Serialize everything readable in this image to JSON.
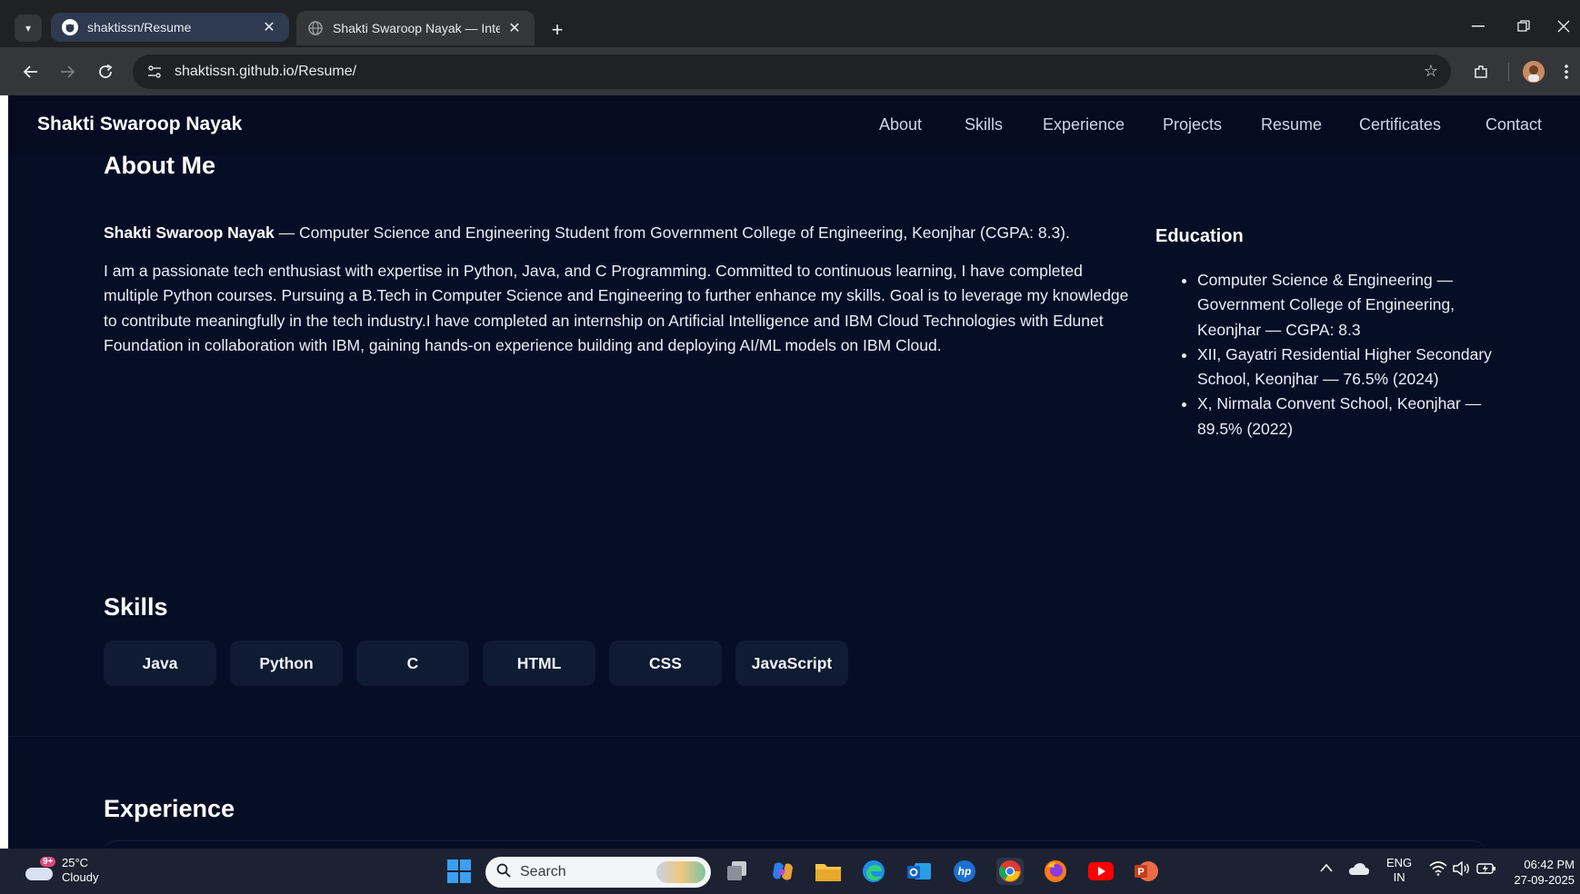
{
  "browser": {
    "tabs": [
      {
        "title": "shaktissn/Resume",
        "close": "✕"
      },
      {
        "title": "Shakti Swaroop Nayak — Intera",
        "close": "✕"
      }
    ],
    "new_tab": "+",
    "url": "shaktissn.github.io/Resume/"
  },
  "site": {
    "brand": "Shakti Swaroop Nayak",
    "nav": [
      "About",
      "Skills",
      "Experience",
      "Projects",
      "Resume",
      "Certificates",
      "Contact"
    ]
  },
  "about": {
    "title": "About Me",
    "intro_name": "Shakti Swaroop Nayak",
    "intro_rest": " — Computer Science and Engineering Student from Government College of Engineering, Keonjhar (CGPA: 8.3).",
    "body": "I am a passionate tech enthusiast with expertise in Python, Java, and C Programming. Committed to continuous learning, I have completed multiple Python courses. Pursuing a B.Tech in Computer Science and Engineering to further enhance my skills. Goal is to leverage my knowledge to contribute meaningfully in the tech industry.I have completed an internship on Artificial Intelligence and IBM Cloud Technologies with Edunet Foundation in collaboration with IBM, gaining hands-on experience building and deploying AI/ML models on IBM Cloud."
  },
  "education": {
    "title": "Education",
    "items": [
      "Computer Science & Engineering — Government College of Engineering, Keonjhar — CGPA: 8.3",
      "XII, Gayatri Residential Higher Secondary School, Keonjhar — 76.5% (2024)",
      "X, Nirmala Convent School, Keonjhar — 89.5% (2022)"
    ]
  },
  "skills": {
    "title": "Skills",
    "items": [
      "Java",
      "Python",
      "C",
      "HTML",
      "CSS",
      "JavaScript"
    ]
  },
  "experience": {
    "title": "Experience"
  },
  "taskbar": {
    "weather_badge": "9+",
    "temperature": "25°C",
    "condition": "Cloudy",
    "search": "Search",
    "lang_top": "ENG",
    "lang_bottom": "IN",
    "time": "06:42 PM",
    "date": "27-09-2025"
  }
}
